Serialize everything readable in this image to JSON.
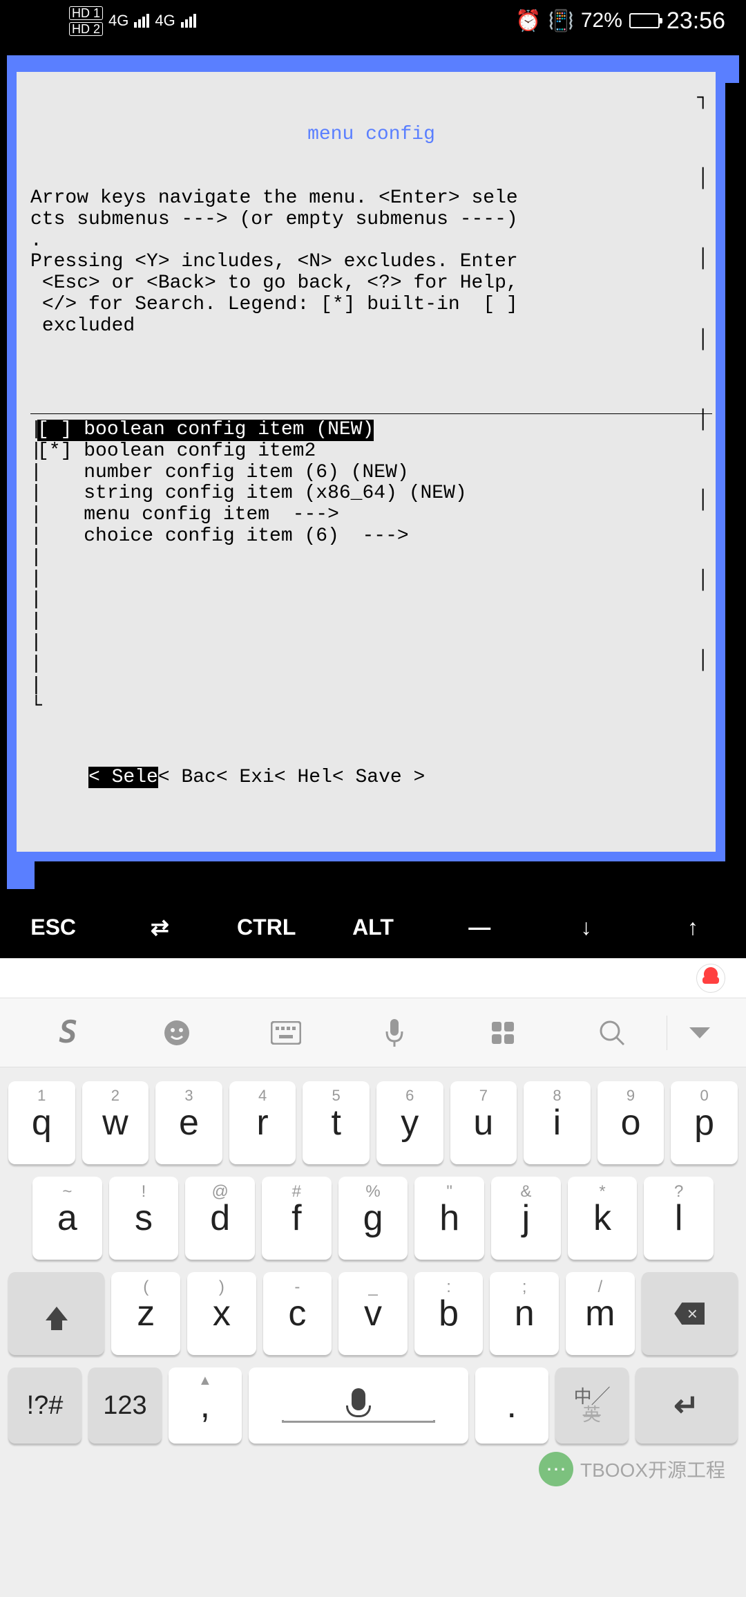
{
  "status": {
    "hd1": "HD 1",
    "hd2": "HD 2",
    "net1": "4G",
    "net2": "4G",
    "battery_pct": "72%",
    "time": "23:56"
  },
  "terminal": {
    "title": "menu config",
    "help_lines": "Arrow keys navigate the menu. <Enter> sele\ncts submenus ---> (or empty submenus ----)\n.\nPressing <Y> includes, <N> excludes. Enter\n <Esc> or <Back> to go back, <?> for Help,\n </> for Search. Legend: [*] built-in  [ ]\n excluded",
    "items": [
      {
        "prefix": "[ ]",
        "label": "boolean config item (NEW)",
        "selected": true
      },
      {
        "prefix": "[*]",
        "label": "boolean config item2",
        "selected": false
      },
      {
        "prefix": "   ",
        "label": "number config item (6) (NEW)",
        "selected": false
      },
      {
        "prefix": "   ",
        "label": "string config item (x86_64) (NEW)",
        "selected": false
      },
      {
        "prefix": "   ",
        "label": "menu config item  --->",
        "selected": false
      },
      {
        "prefix": "   ",
        "label": "choice config item (6)  --->",
        "selected": false
      }
    ],
    "bottom": {
      "sel_prefix": "<",
      "sel": " Sele",
      "rest": "< Bac< Exi< Hel< Save >"
    }
  },
  "extra_keys": [
    "ESC",
    "⇄",
    "CTRL",
    "ALT",
    "—",
    "↓",
    "↑"
  ],
  "ime_tools": [
    "S",
    "😉",
    "⌨",
    "🎤",
    "◧",
    "🔍",
    "▼"
  ],
  "keyboard": {
    "row1": [
      {
        "n": "1",
        "c": "q"
      },
      {
        "n": "2",
        "c": "w"
      },
      {
        "n": "3",
        "c": "e"
      },
      {
        "n": "4",
        "c": "r"
      },
      {
        "n": "5",
        "c": "t"
      },
      {
        "n": "6",
        "c": "y"
      },
      {
        "n": "7",
        "c": "u"
      },
      {
        "n": "8",
        "c": "i"
      },
      {
        "n": "9",
        "c": "o"
      },
      {
        "n": "0",
        "c": "p"
      }
    ],
    "row2": [
      {
        "s": "~",
        "c": "a"
      },
      {
        "s": "!",
        "c": "s"
      },
      {
        "s": "@",
        "c": "d"
      },
      {
        "s": "#",
        "c": "f"
      },
      {
        "s": "%",
        "c": "g"
      },
      {
        "s": "\"",
        "c": "h"
      },
      {
        "s": "&",
        "c": "j"
      },
      {
        "s": "*",
        "c": "k"
      },
      {
        "s": "?",
        "c": "l"
      }
    ],
    "row3": [
      {
        "s": "(",
        "c": "z"
      },
      {
        "s": ")",
        "c": "x"
      },
      {
        "s": "-",
        "c": "c"
      },
      {
        "s": "_",
        "c": "v"
      },
      {
        "s": ":",
        "c": "b"
      },
      {
        "s": ";",
        "c": "n"
      },
      {
        "s": "/",
        "c": "m"
      }
    ],
    "row4": {
      "symnum": "!?#",
      "num": "123",
      "comma": ",",
      "period": ".",
      "lang_top": "中",
      "lang_bot": "英"
    }
  },
  "watermark": "TBOOX开源工程"
}
